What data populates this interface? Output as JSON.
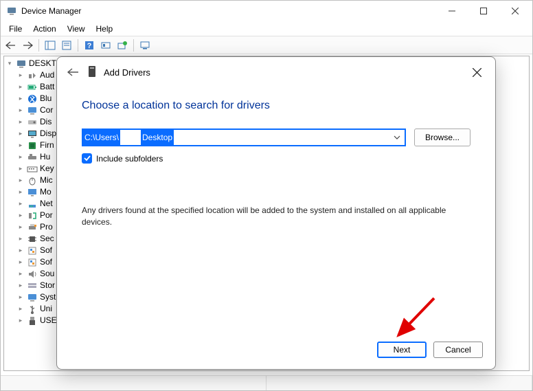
{
  "window": {
    "title": "Device Manager"
  },
  "menu": {
    "file": "File",
    "action": "Action",
    "view": "View",
    "help": "Help"
  },
  "tree": {
    "root": "DESKTC",
    "items": [
      {
        "label": "Aud",
        "icon": "audio"
      },
      {
        "label": "Batt",
        "icon": "battery"
      },
      {
        "label": "Blu",
        "icon": "bluetooth"
      },
      {
        "label": "Cor",
        "icon": "computer"
      },
      {
        "label": "Dis",
        "icon": "diskdrive"
      },
      {
        "label": "Disp",
        "icon": "display"
      },
      {
        "label": "Firn",
        "icon": "firmware"
      },
      {
        "label": "Hu",
        "icon": "hid"
      },
      {
        "label": "Key",
        "icon": "keyboard"
      },
      {
        "label": "Mic",
        "icon": "mouse"
      },
      {
        "label": "Mo",
        "icon": "monitor"
      },
      {
        "label": "Net",
        "icon": "network"
      },
      {
        "label": "Por",
        "icon": "ports"
      },
      {
        "label": "Pro",
        "icon": "printqueue"
      },
      {
        "label": "Sec",
        "icon": "processor"
      },
      {
        "label": "Sof",
        "icon": "software"
      },
      {
        "label": "Sof",
        "icon": "software"
      },
      {
        "label": "Sou",
        "icon": "sound"
      },
      {
        "label": "Stor",
        "icon": "storage"
      },
      {
        "label": "Syst",
        "icon": "system"
      },
      {
        "label": "Uni",
        "icon": "usb"
      },
      {
        "label": "USE",
        "icon": "usbconn"
      }
    ]
  },
  "dialog": {
    "title": "Add Drivers",
    "heading": "Choose a location to search for drivers",
    "path_prefix": "C:\\Users\\",
    "path_suffix": "Desktop",
    "browse": "Browse...",
    "include_subfolders": "Include subfolders",
    "include_checked": true,
    "info": "Any drivers found at the specified location will be added to the system and installed on all applicable devices.",
    "next": "Next",
    "cancel": "Cancel"
  }
}
